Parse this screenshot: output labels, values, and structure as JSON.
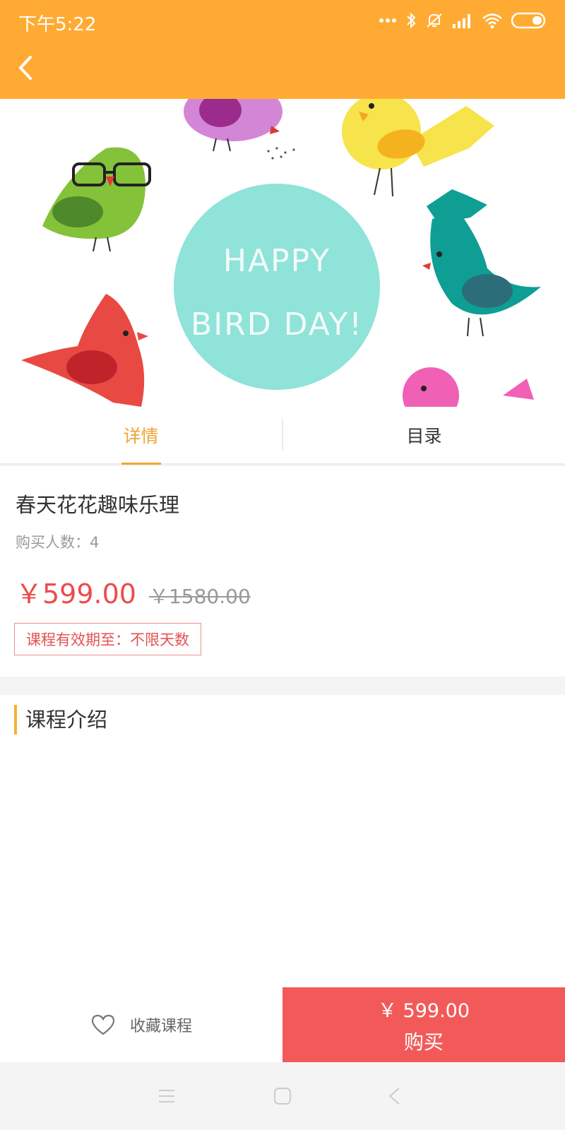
{
  "status_bar": {
    "time": "下午5:22",
    "icons": [
      "more-dots-icon",
      "bluetooth-icon",
      "mute-icon",
      "signal-icon",
      "wifi-icon",
      "battery-icon"
    ]
  },
  "header": {
    "back_icon": "chevron-left-icon",
    "color": "#ffab33"
  },
  "banner": {
    "line1": "HAPPY",
    "line2": "BIRD DAY!"
  },
  "tabs": [
    {
      "label": "详情",
      "active": true
    },
    {
      "label": "目录",
      "active": false
    }
  ],
  "course": {
    "title": "春天花花趣味乐理",
    "buyers": "购买人数：4",
    "price": "￥599.00",
    "original_price": "￥1580.00",
    "validity": "课程有效期至：不限天数"
  },
  "intro": {
    "title": "课程介绍"
  },
  "action_bar": {
    "favorite_label": "收藏课程",
    "buy_price": "￥ 599.00",
    "buy_label": "购买",
    "buy_color": "#f25a5a"
  },
  "nav_bar": {
    "icons": [
      "menu-icon",
      "home-icon",
      "back-icon"
    ]
  }
}
